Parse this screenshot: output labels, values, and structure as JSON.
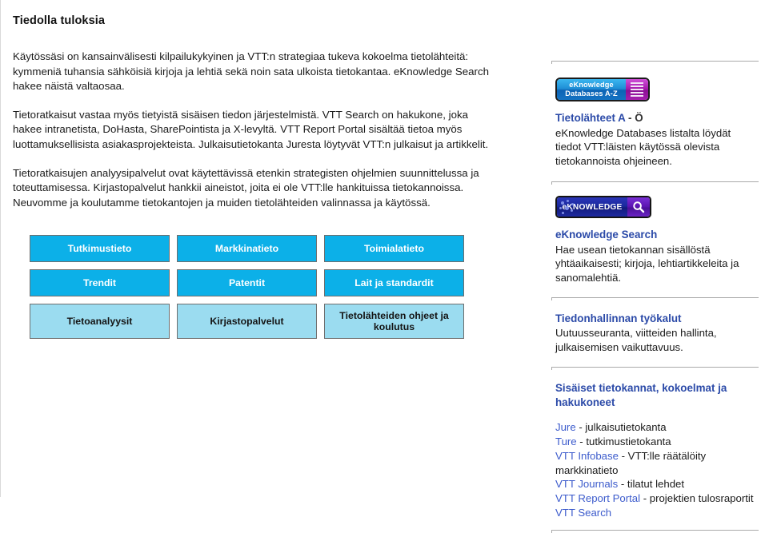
{
  "main": {
    "title": "Tiedolla tuloksia",
    "paragraphs": [
      "Käytössäsi on kansainvälisesti kilpailukykyinen ja VTT:n strategiaa tukeva kokoelma tietolähteitä: kymmeniä tuhansia sähköisiä kirjoja ja lehtiä sekä noin sata ulkoista tietokantaa. eKnowledge Search hakee näistä valtaosaa.",
      "Tietoratkaisut vastaa myös tietyistä sisäisen tiedon järjestelmistä. VTT Search on hakukone, joka hakee intranetista, DoHasta, SharePointista ja X-levyltä. VTT Report Portal sisältää tietoa myös luottamuksellisista asiakasprojekteista. Julkaisutietokanta Juresta löytyvät VTT:n julkaisut ja artikkelit.",
      "Tietoratkaisujen analyysipalvelut ovat käytettävissä etenkin strategisten ohjelmien suunnittelussa ja toteuttamisessa. Kirjastopalvelut hankkii aineistot, joita ei ole VTT:lle hankituissa tietokannoissa. Neuvomme ja koulutamme tietokantojen ja muiden tietolähteiden valinnassa ja käytössä."
    ],
    "button_grid": {
      "rows": [
        {
          "style": "bright",
          "tall": false,
          "buttons": [
            {
              "label": "Tutkimustieto"
            },
            {
              "label": "Markkinatieto"
            },
            {
              "label": "Toimialatieto"
            }
          ]
        },
        {
          "style": "bright",
          "tall": false,
          "buttons": [
            {
              "label": "Trendit"
            },
            {
              "label": "Patentit"
            },
            {
              "label": "Lait ja standardit"
            }
          ]
        },
        {
          "style": "light",
          "tall": true,
          "buttons": [
            {
              "label": "Tietoanalyysit"
            },
            {
              "label": "Kirjastopalvelut"
            },
            {
              "label": "Tietolähteiden ohjeet ja koulutus"
            }
          ]
        }
      ]
    }
  },
  "sidebar": {
    "blocks": [
      {
        "badge": {
          "name": "eknowledge-databases-az-badge",
          "line1": "eKnowledge",
          "line2": "Databases A-Z"
        },
        "heading": "Tietolähteet A",
        "heading_suffix": " - Ö",
        "description": "eKnowledge Databases listalta löydät tiedot VTT:läisten käytössä olevista tietokannoista ohjeineen."
      },
      {
        "badge": {
          "name": "eknowledge-search-badge",
          "label": "eKNOWLEDGE",
          "icon": "magnifier-icon"
        },
        "heading": "eKnowledge Search",
        "heading_suffix": "",
        "description": "Hae usean tietokannan sisällöstä yhtäaikaisesti; kirjoja, lehtiartikkeleita ja sanomalehtiä."
      },
      {
        "heading": "Tiedonhallinnan työkalut",
        "heading_suffix": "",
        "description": "Uutuusseuranta, viitteiden hallinta, julkaisemisen vaikuttavuus."
      }
    ],
    "internal": {
      "heading": "Sisäiset tietokannat, kokoelmat ja hakukoneet",
      "links": [
        {
          "label": "Jure",
          "desc": " - julkaisutietokanta"
        },
        {
          "label": "Ture",
          "desc": " - tutkimustietokanta"
        },
        {
          "label": "VTT Infobase",
          "desc": " - VTT:lle räätälöity markkinatieto"
        },
        {
          "label": "VTT Journals",
          "desc": " - tilatut lehdet"
        },
        {
          "label": "VTT Report Portal",
          "desc": " - projektien tulosraportit"
        },
        {
          "label": "VTT Search",
          "desc": ""
        }
      ]
    }
  },
  "colors": {
    "button_bright": "#0cb0e8",
    "button_light": "#9bdcf0",
    "link_blue": "#3c5bcc",
    "heading_blue": "#2b4aa8"
  }
}
